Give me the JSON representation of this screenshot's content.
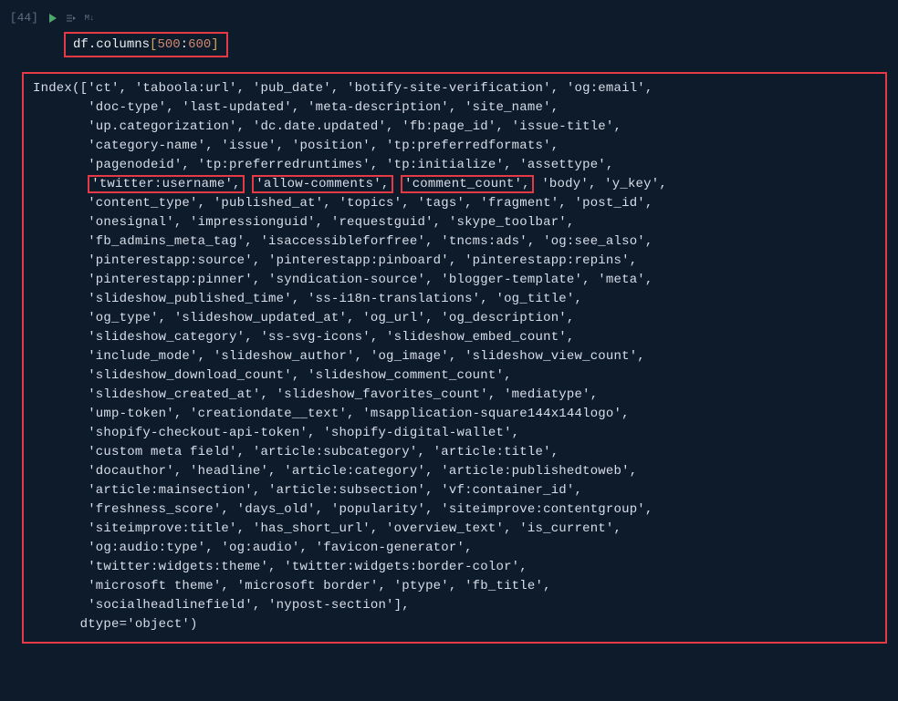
{
  "cell_label": "[44]",
  "code": {
    "object": "df",
    "property": ".columns",
    "bracket_open": "[",
    "start": "500",
    "colon": ":",
    "end": "600",
    "bracket_close": "]"
  },
  "output": {
    "line01": "Index(['ct', 'taboola:url', 'pub_date', 'botify-site-verification', 'og:email',",
    "line02": "       'doc-type', 'last-updated', 'meta-description', 'site_name',",
    "line03": "       'up.categorization', 'dc.date.updated', 'fb:page_id', 'issue-title',",
    "line04": "       'category-name', 'issue', 'position', 'tp:preferredformats',",
    "line05": "       'pagenodeid', 'tp:preferredruntimes', 'tp:initialize', 'assettype',",
    "line06_prefix": "       ",
    "line06_h1": "'twitter:username',",
    "line06_sep1": " ",
    "line06_h2": "'allow-comments',",
    "line06_sep2": " ",
    "line06_h3": "'comment_count',",
    "line06_suffix": " 'body', 'y_key',",
    "line07": "       'content_type', 'published_at', 'topics', 'tags', 'fragment', 'post_id',",
    "line08": "       'onesignal', 'impressionguid', 'requestguid', 'skype_toolbar',",
    "line09": "       'fb_admins_meta_tag', 'isaccessibleforfree', 'tncms:ads', 'og:see_also',",
    "line10": "       'pinterestapp:source', 'pinterestapp:pinboard', 'pinterestapp:repins',",
    "line11": "       'pinterestapp:pinner', 'syndication-source', 'blogger-template', 'meta',",
    "line12": "       'slideshow_published_time', 'ss-i18n-translations', 'og_title',",
    "line13": "       'og_type', 'slideshow_updated_at', 'og_url', 'og_description',",
    "line14": "       'slideshow_category', 'ss-svg-icons', 'slideshow_embed_count',",
    "line15": "       'include_mode', 'slideshow_author', 'og_image', 'slideshow_view_count',",
    "line16": "       'slideshow_download_count', 'slideshow_comment_count',",
    "line17": "       'slideshow_created_at', 'slideshow_favorites_count', 'mediatype',",
    "line18": "       'ump-token', 'creationdate__text', 'msapplication-square144x144logo',",
    "line19": "       'shopify-checkout-api-token', 'shopify-digital-wallet',",
    "line20": "       'custom meta field', 'article:subcategory', 'article:title',",
    "line21": "       'docauthor', 'headline', 'article:category', 'article:publishedtoweb',",
    "line22": "       'article:mainsection', 'article:subsection', 'vf:container_id',",
    "line23": "       'freshness_score', 'days_old', 'popularity', 'siteimprove:contentgroup',",
    "line24": "       'siteimprove:title', 'has_short_url', 'overview_text', 'is_current',",
    "line25": "       'og:audio:type', 'og:audio', 'favicon-generator',",
    "line26": "       'twitter:widgets:theme', 'twitter:widgets:border-color',",
    "line27": "       'microsoft theme', 'microsoft border', 'ptype', 'fb_title',",
    "line28": "       'socialheadlinefield', 'nypost-section'],",
    "line29": "      dtype='object')"
  }
}
